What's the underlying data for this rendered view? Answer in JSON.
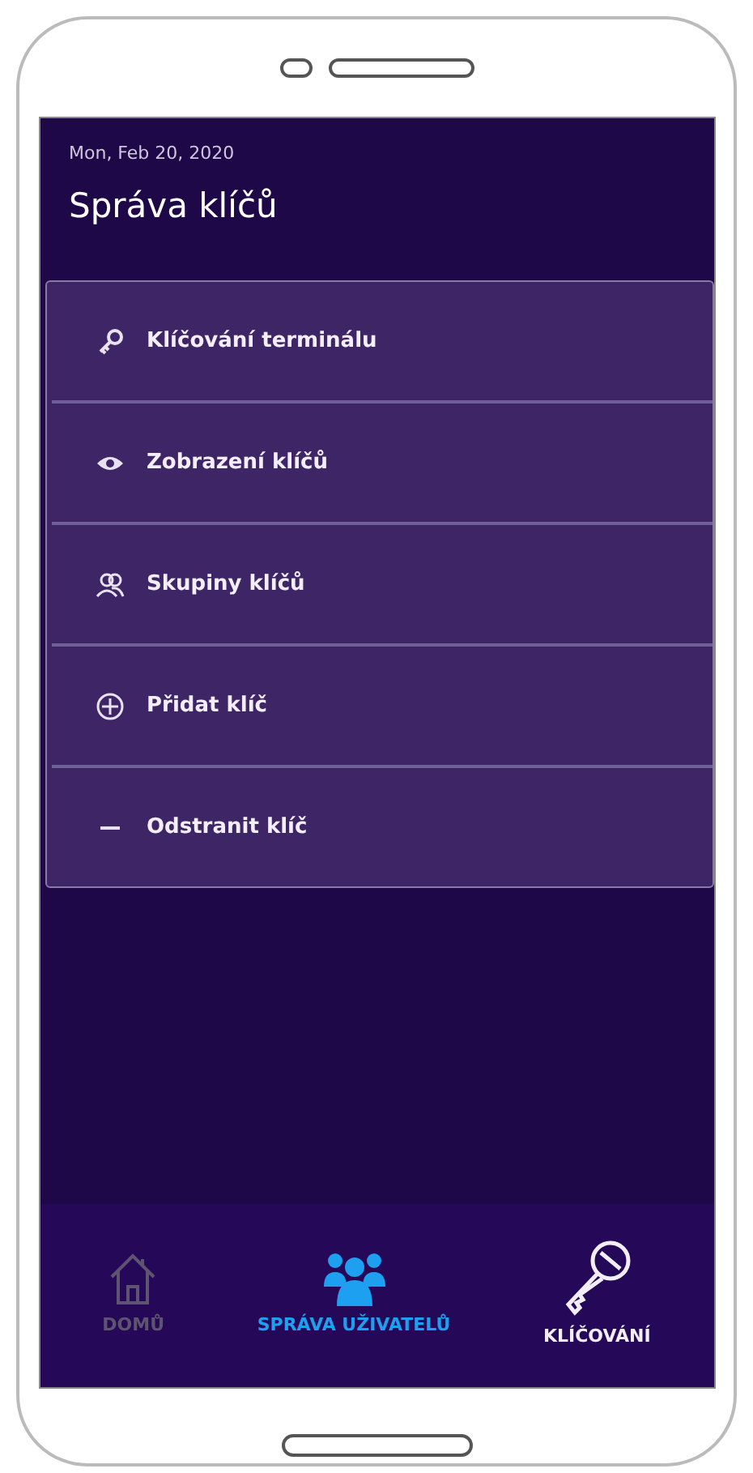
{
  "header": {
    "date": "Mon, Feb 20, 2020",
    "title": "Správa klíčů"
  },
  "menu": [
    {
      "label": "Klíčování terminálu",
      "kind": "key"
    },
    {
      "label": "Zobrazení klíčů",
      "kind": "eye"
    },
    {
      "label": "Skupiny klíčů",
      "kind": "group"
    },
    {
      "label": "Přidat klíč",
      "kind": "plus"
    },
    {
      "label": "Odstranit klíč",
      "kind": "minus"
    }
  ],
  "bottom_nav": [
    {
      "label": "DOMŮ",
      "kind": "home",
      "color": "#5e5470"
    },
    {
      "label": "SPRÁVA UŽIVATELŮ",
      "kind": "users",
      "color": "#1ea0f0"
    },
    {
      "label": "KLÍČOVÁNÍ",
      "kind": "key",
      "color": "#f2eef8"
    }
  ]
}
